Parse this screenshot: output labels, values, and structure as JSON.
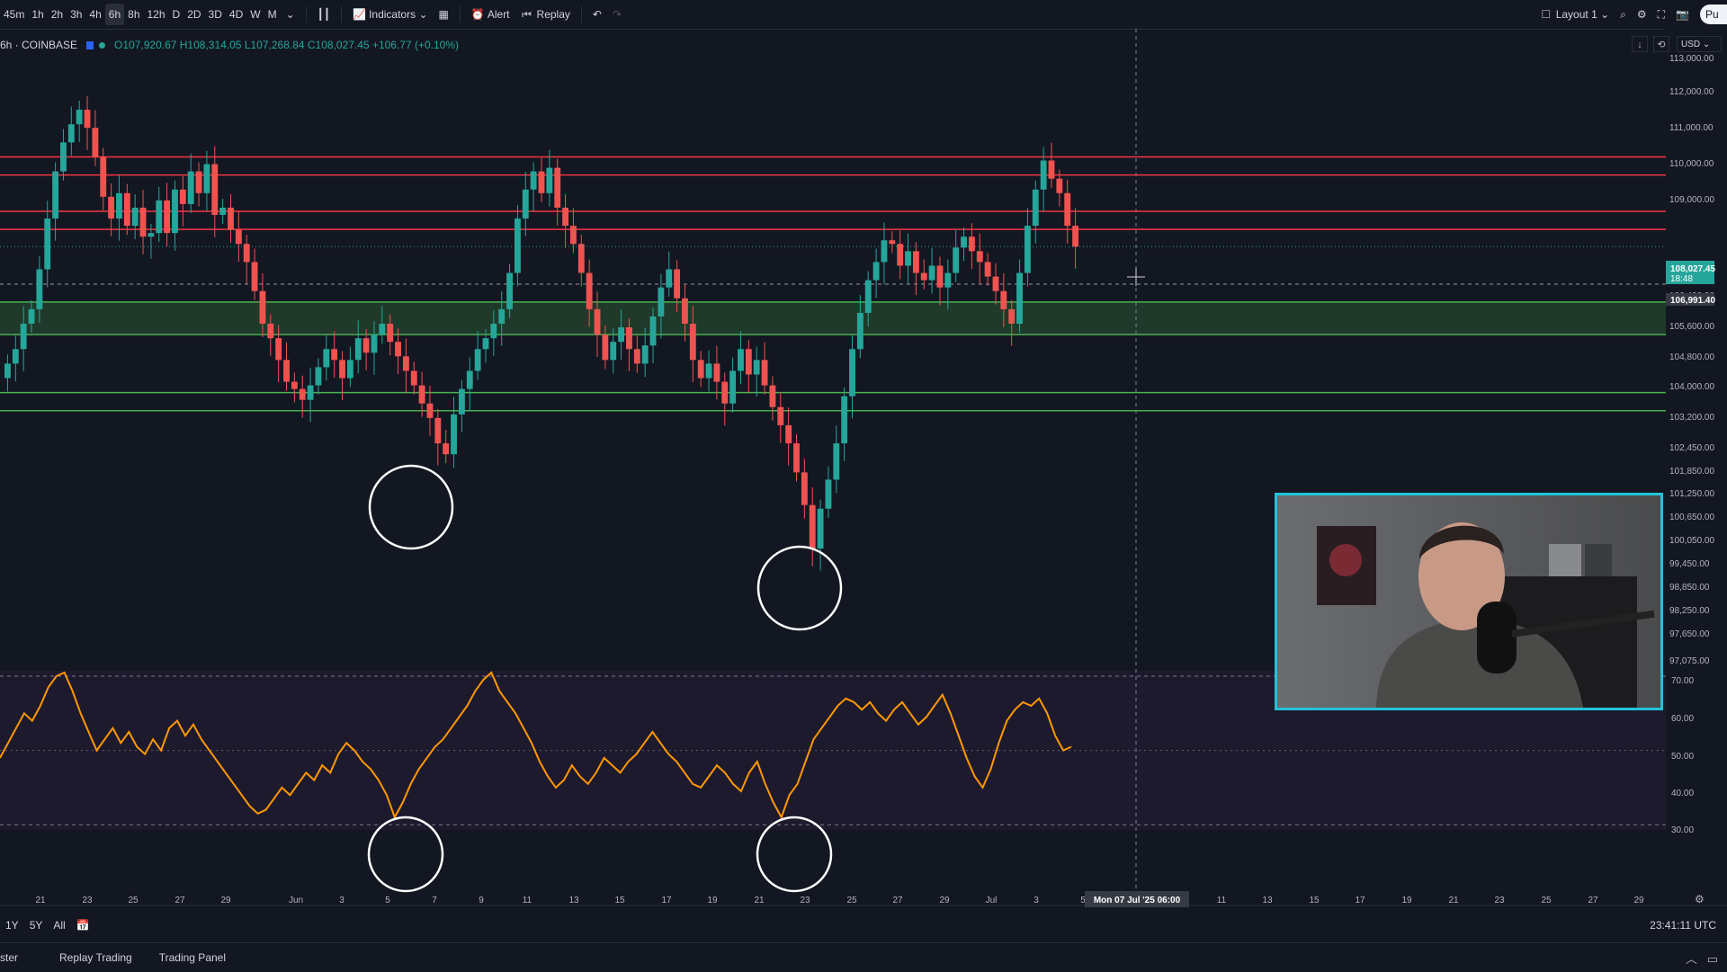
{
  "toolbar": {
    "intervals": [
      "45m",
      "1h",
      "2h",
      "3h",
      "4h",
      "6h",
      "8h",
      "12h",
      "D",
      "2D",
      "3D",
      "4D",
      "W",
      "M"
    ],
    "active_interval": "6h",
    "indicators_label": "Indicators",
    "alert_label": "Alert",
    "replay_label": "Replay",
    "layout_label": "Layout 1",
    "publish_label": "Pu"
  },
  "legend": {
    "symbol": "6h · COINBASE",
    "ohlc": "O107,920.67 H108,314.05 L107,268.84 C108,027.45 +106.77 (+0.10%)"
  },
  "currency": "USD",
  "colors": {
    "background": "#131722",
    "up": "#26a69a",
    "down": "#ef5350",
    "resistance": "#f23645",
    "support": "#4caf50",
    "support_zone": "#1f3a2a",
    "rsi": "#ff9800",
    "rsi_bg": "#1e1a2e",
    "webcam_border": "#22c3d8"
  },
  "chart_data": [
    {
      "type": "line",
      "name_shown": "",
      "xlabel": "",
      "ylabel": "",
      "x_ticks": [
        "21",
        "23",
        "25",
        "27",
        "29",
        "Jun",
        "3",
        "5",
        "7",
        "9",
        "11",
        "13",
        "15",
        "17",
        "19",
        "21",
        "23",
        "25",
        "27",
        "29",
        "Jul",
        "3",
        "5",
        "Mon 07 Jul '25  06:00",
        "11",
        "13",
        "15",
        "17",
        "19",
        "21",
        "23",
        "25",
        "27",
        "29"
      ],
      "price_ticks": [
        "113,000.00",
        "112,000.00",
        "111,000.00",
        "110,000.00",
        "109,000.00",
        "107,200.00",
        "106,400.00",
        "105,600.00",
        "104,800.00",
        "104,000.00",
        "103,200.00",
        "102,450.00",
        "101,850.00",
        "101,250.00",
        "100,650.00",
        "100,050.00",
        "99,450.00",
        "98,850.00",
        "98,250.00",
        "97,650.00",
        "97,075.00"
      ],
      "last_price_label": "108,027.45",
      "countdown_label": "18:48",
      "crosshair_price_label": "106,991.40",
      "resistance_levels": [
        110500,
        110000,
        109000,
        108500
      ],
      "support_zone": [
        105600,
        106500
      ],
      "support_levels": [
        104000,
        103500
      ],
      "close_series": [
        104800,
        105200,
        105900,
        106300,
        107400,
        108800,
        110100,
        110900,
        111400,
        111800,
        111300,
        110500,
        109400,
        108800,
        109500,
        108600,
        109100,
        108300,
        108400,
        109300,
        108400,
        109600,
        109200,
        110100,
        109500,
        110300,
        108900,
        109100,
        108500,
        108100,
        107600,
        106800,
        105900,
        105500,
        104900,
        104300,
        104100,
        103800,
        104200,
        104700,
        105200,
        104900,
        104400,
        104900,
        105500,
        105100,
        105600,
        105900,
        105400,
        105000,
        104600,
        104200,
        103700,
        103300,
        102600,
        102300,
        103400,
        104100,
        104600,
        105200,
        105500,
        105900,
        106300,
        107300,
        108800,
        109600,
        110100,
        109500,
        110200,
        109100,
        108600,
        108100,
        107300,
        106300,
        105600,
        104900,
        105400,
        105800,
        105200,
        104800,
        105300,
        106100,
        106900,
        107400,
        106600,
        105900,
        104900,
        104400,
        104800,
        104300,
        103700,
        104600,
        105200,
        104500,
        104900,
        104200,
        103600,
        103100,
        102600,
        101800,
        100900,
        99700,
        100800,
        101600,
        102600,
        103900,
        105200,
        106200,
        107100,
        107600,
        108200,
        108100,
        107500,
        107900,
        107300,
        107100,
        107500,
        106900,
        107300,
        108000,
        108300,
        107900,
        107600,
        107200,
        106800,
        106300,
        105900,
        107300,
        108600,
        109600,
        110400,
        109900,
        109500,
        108600,
        108027
      ],
      "rsi_ticks": [
        "70.00",
        "60.00",
        "50.00",
        "40.00",
        "30.00"
      ],
      "rsi_levels": [
        70,
        30
      ],
      "rsi_series": [
        48,
        52,
        56,
        60,
        58,
        62,
        67,
        70,
        71,
        66,
        60,
        55,
        50,
        53,
        56,
        52,
        55,
        51,
        49,
        53,
        50,
        56,
        58,
        54,
        57,
        53,
        50,
        47,
        44,
        41,
        38,
        35,
        33,
        34,
        37,
        40,
        38,
        41,
        44,
        42,
        46,
        44,
        49,
        52,
        50,
        47,
        45,
        42,
        38,
        32,
        36,
        41,
        45,
        48,
        51,
        53,
        56,
        59,
        62,
        66,
        69,
        71,
        66,
        63,
        60,
        56,
        52,
        47,
        43,
        40,
        42,
        46,
        43,
        41,
        44,
        48,
        46,
        44,
        47,
        49,
        52,
        55,
        52,
        49,
        47,
        44,
        41,
        40,
        43,
        46,
        44,
        41,
        39,
        44,
        47,
        41,
        36,
        32,
        38,
        41,
        47,
        53,
        56,
        59,
        62,
        64,
        63,
        61,
        63,
        60,
        58,
        61,
        63,
        60,
        57,
        59,
        62,
        65,
        60,
        54,
        48,
        43,
        40,
        45,
        52,
        58,
        61,
        63,
        62,
        64,
        60,
        54,
        50,
        51
      ],
      "annotations": [
        "circle",
        "circle",
        "circle",
        "circle"
      ]
    }
  ],
  "bottom": {
    "ranges": [
      "1Y",
      "5Y",
      "All"
    ],
    "time": "23:41:11 UTC",
    "tabs": [
      "ster",
      "Replay Trading",
      "Trading Panel"
    ]
  }
}
